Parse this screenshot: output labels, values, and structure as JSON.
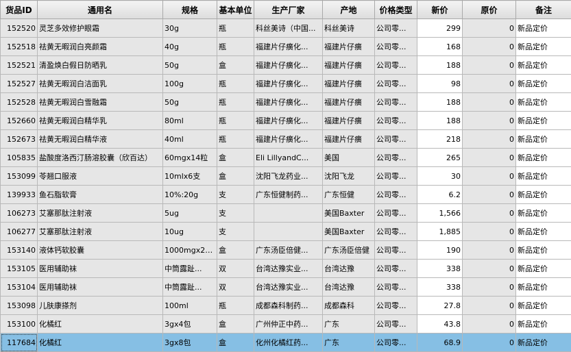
{
  "columns": [
    "货品ID",
    "通用名",
    "规格",
    "基本单位",
    "生产厂家",
    "产地",
    "价格类型",
    "新价",
    "原价",
    "备注"
  ],
  "rows": [
    {
      "id": "152520",
      "name": "灵芝多效修护眼霜",
      "spec": "30g",
      "unit": "瓶",
      "maker": "科丝美诗（中国...",
      "origin": "科丝美诗",
      "price_type": "公司零...",
      "new_price": "299",
      "old_price": "0",
      "remark": "新品定价"
    },
    {
      "id": "152518",
      "name": "祛黄无暇润白亮颜霜",
      "spec": "40g",
      "unit": "瓶",
      "maker": "福建片仔癀化...",
      "origin": "福建片仔癀",
      "price_type": "公司零...",
      "new_price": "168",
      "old_price": "0",
      "remark": "新品定价"
    },
    {
      "id": "152521",
      "name": "清盈焕白假日防晒乳",
      "spec": "50g",
      "unit": "盒",
      "maker": "福建片仔癀化...",
      "origin": "福建片仔癀",
      "price_type": "公司零...",
      "new_price": "188",
      "old_price": "0",
      "remark": "新品定价"
    },
    {
      "id": "152527",
      "name": "祛黄无暇润白洁面乳",
      "spec": "100g",
      "unit": "瓶",
      "maker": "福建片仔癀化...",
      "origin": "福建片仔癀",
      "price_type": "公司零...",
      "new_price": "98",
      "old_price": "0",
      "remark": "新品定价"
    },
    {
      "id": "152528",
      "name": "祛黄无暇润白雪融霜",
      "spec": "50g",
      "unit": "瓶",
      "maker": "福建片仔癀化...",
      "origin": "福建片仔癀",
      "price_type": "公司零...",
      "new_price": "188",
      "old_price": "0",
      "remark": "新品定价"
    },
    {
      "id": "152660",
      "name": "祛黄无暇润白精华乳",
      "spec": "80ml",
      "unit": "瓶",
      "maker": "福建片仔癀化...",
      "origin": "福建片仔癀",
      "price_type": "公司零...",
      "new_price": "188",
      "old_price": "0",
      "remark": "新品定价"
    },
    {
      "id": "152673",
      "name": "祛黄无暇润白精华液",
      "spec": "40ml",
      "unit": "瓶",
      "maker": "福建片仔癀化...",
      "origin": "福建片仔癀",
      "price_type": "公司零...",
      "new_price": "218",
      "old_price": "0",
      "remark": "新品定价"
    },
    {
      "id": "105835",
      "name": "盐酸度洛西汀肠溶胶囊（欣百达）",
      "spec": "60mgx14粒",
      "unit": "盒",
      "maker": "Eli LillyandC...",
      "origin": "美国",
      "price_type": "公司零...",
      "new_price": "265",
      "old_price": "0",
      "remark": "新品定价"
    },
    {
      "id": "153099",
      "name": "苓翘口服液",
      "spec": "10mlx6支",
      "unit": "盒",
      "maker": "沈阳飞龙药业...",
      "origin": "沈阳飞龙",
      "price_type": "公司零...",
      "new_price": "30",
      "old_price": "0",
      "remark": "新品定价"
    },
    {
      "id": "139933",
      "name": "鱼石脂软膏",
      "spec": "10%:20g",
      "unit": "支",
      "maker": "广东恒健制药...",
      "origin": "广东恒健",
      "price_type": "公司零...",
      "new_price": "6.2",
      "old_price": "0",
      "remark": "新品定价"
    },
    {
      "id": "106273",
      "name": "艾塞那肽注射液",
      "spec": "5ug",
      "unit": "支",
      "maker": "",
      "origin": "美国Baxter",
      "price_type": "公司零...",
      "new_price": "1,566",
      "old_price": "0",
      "remark": "新品定价"
    },
    {
      "id": "106277",
      "name": "艾塞那肽注射液",
      "spec": "10ug",
      "unit": "支",
      "maker": "",
      "origin": "美国Baxter",
      "price_type": "公司零...",
      "new_price": "1,885",
      "old_price": "0",
      "remark": "新品定价"
    },
    {
      "id": "153140",
      "name": "液体钙软胶囊",
      "spec": "1000mgx20...",
      "unit": "盒",
      "maker": "广东汤臣倍健...",
      "origin": "广东汤臣倍健",
      "price_type": "公司零...",
      "new_price": "190",
      "old_price": "0",
      "remark": "新品定价"
    },
    {
      "id": "153105",
      "name": "医用辅助袜",
      "spec": "中筒露趾...",
      "unit": "双",
      "maker": "台湾达豫实业...",
      "origin": "台湾达豫",
      "price_type": "公司零...",
      "new_price": "338",
      "old_price": "0",
      "remark": "新品定价"
    },
    {
      "id": "153104",
      "name": "医用辅助袜",
      "spec": "中筒露趾...",
      "unit": "双",
      "maker": "台湾达豫实业...",
      "origin": "台湾达豫",
      "price_type": "公司零...",
      "new_price": "338",
      "old_price": "0",
      "remark": "新品定价"
    },
    {
      "id": "153098",
      "name": "儿肤康搽剂",
      "spec": "100ml",
      "unit": "瓶",
      "maker": "成都森科制药...",
      "origin": "成都森科",
      "price_type": "公司零...",
      "new_price": "27.8",
      "old_price": "0",
      "remark": "新品定价"
    },
    {
      "id": "153100",
      "name": "化橘红",
      "spec": "3gx4包",
      "unit": "盒",
      "maker": "广州仲正中药...",
      "origin": "广东",
      "price_type": "公司零...",
      "new_price": "43.8",
      "old_price": "0",
      "remark": "新品定价"
    },
    {
      "id": "117684",
      "name": "化橘红",
      "spec": "3gx8包",
      "unit": "盒",
      "maker": "化州化橘红药...",
      "origin": "广东",
      "price_type": "公司零...",
      "new_price": "68.9",
      "old_price": "0",
      "remark": "新品定价"
    }
  ],
  "selected_row_index": 17
}
